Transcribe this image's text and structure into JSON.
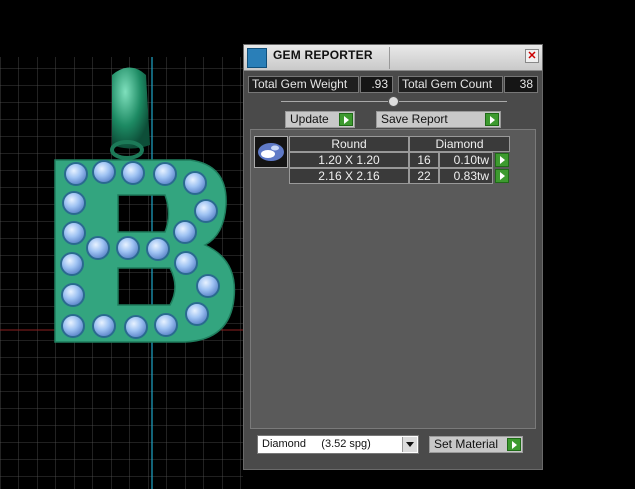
{
  "window": {
    "title": "GEM REPORTER"
  },
  "summary": {
    "total_weight_label": "Total Gem Weight",
    "total_weight_value": ".93",
    "total_count_label": "Total Gem Count",
    "total_count_value": "38"
  },
  "toolbar": {
    "update_label": "Update",
    "save_report_label": "Save Report"
  },
  "gem_table": {
    "shape_header": "Round",
    "material_header": "Diamond",
    "rows": [
      {
        "size": "1.20 X 1.20",
        "count": "16",
        "weight": "0.10tw"
      },
      {
        "size": "2.16 X 2.16",
        "count": "22",
        "weight": "0.83tw"
      }
    ]
  },
  "material": {
    "selected": "Diamond     (3.52 spg)",
    "set_label": "Set Material"
  },
  "colors": {
    "accent_green": "#3d9a2f",
    "pendant": "#33a57f",
    "gem": "#9fc3f3"
  }
}
